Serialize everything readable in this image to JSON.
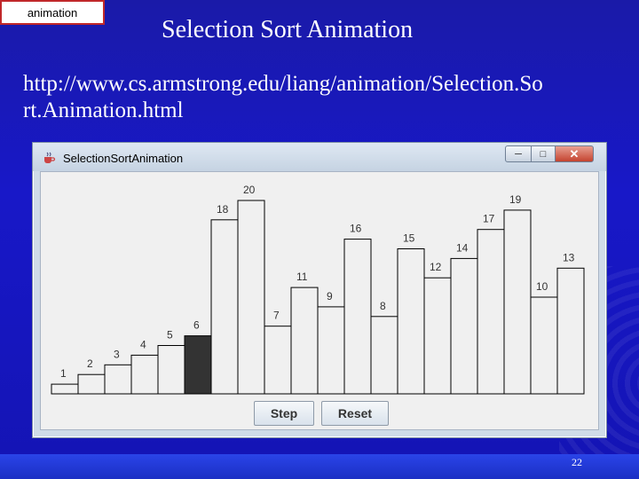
{
  "slide": {
    "tag_label": "animation",
    "title": "Selection Sort Animation",
    "url": "http://www.cs.armstrong.edu/liang/animation/Selection.So\nrt.Animation.html",
    "page_number": "22"
  },
  "window": {
    "title": "SelectionSortAnimation",
    "minimize_icon": "minimize-icon",
    "maximize_icon": "maximize-icon",
    "close_icon": "close-icon",
    "app_icon": "java-cup-icon",
    "bar_values": [
      1,
      2,
      3,
      4,
      5,
      6,
      18,
      20,
      7,
      11,
      9,
      16,
      8,
      15,
      12,
      14,
      17,
      19,
      10,
      13
    ],
    "highlighted_index": 5,
    "highlight_color": "#333333",
    "step_label": "Step",
    "reset_label": "Reset"
  }
}
